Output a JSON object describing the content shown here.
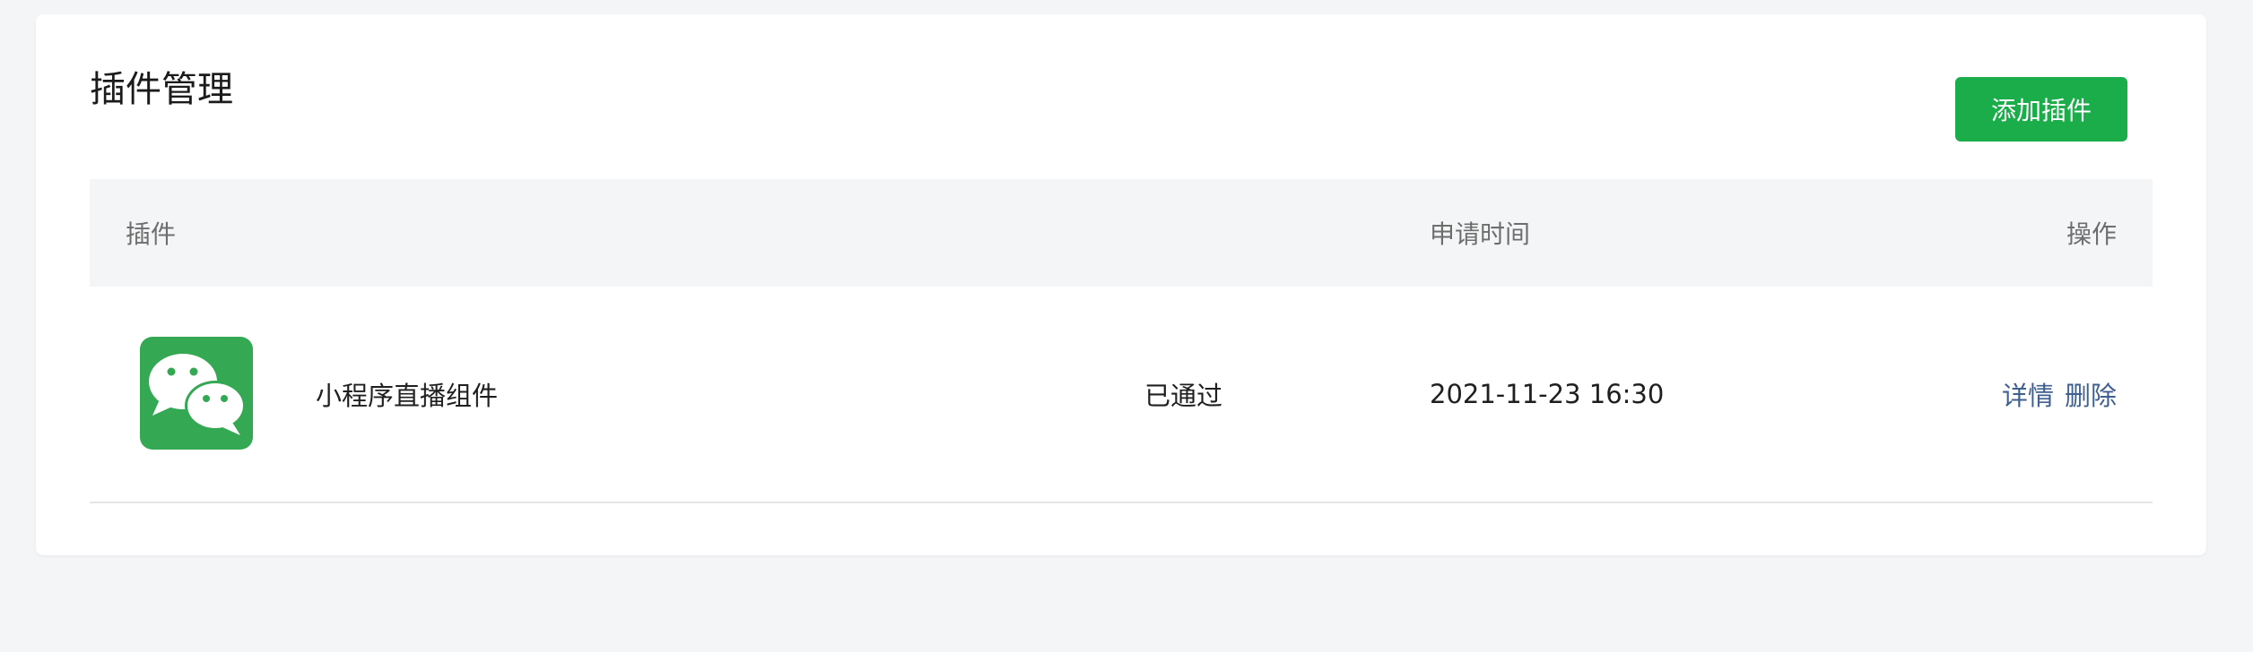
{
  "page": {
    "title": "插件管理",
    "add_button_label": "添加插件"
  },
  "table": {
    "columns": [
      "插件",
      "申请时间",
      "操作"
    ],
    "rows": [
      {
        "icon": "wechat-icon",
        "name": "小程序直播组件",
        "status": "已通过",
        "time": "2021-11-23 16:30",
        "actions": [
          "详情",
          "删除"
        ]
      }
    ]
  },
  "colors": {
    "accent": "#1aad4a",
    "link": "#3f5f8f",
    "logo_bg": "#34a853",
    "header_bg": "#f4f5f6"
  }
}
